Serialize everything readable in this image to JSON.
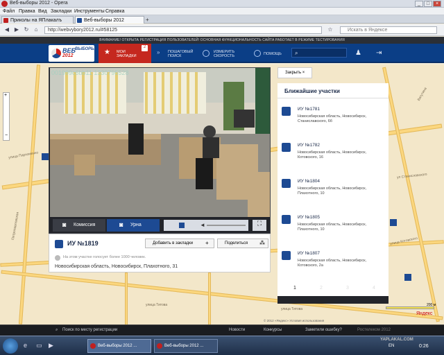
{
  "window": {
    "title": "Веб-выборы 2012 - Opera"
  },
  "menu": [
    "Файл",
    "Правка",
    "Вид",
    "Закладки",
    "Инструменты",
    "Справка"
  ],
  "tabs": [
    {
      "label": "Приколы на ЯПлакалъ"
    },
    {
      "label": "Веб-выборы 2012"
    }
  ],
  "address": {
    "url": "http://webvybory2012.ru/#58125",
    "search_placeholder": "Искать в Яндексе"
  },
  "notice": "ВНИМАНИЕ! ОТКРЫТА РЕГИСТРАЦИЯ ПОЛЬЗОВАТЕЛЕЙ! ОСНОВНАЯ ФУНКЦИОНАЛЬНОСТЬ САЙТА РАБОТАЕТ В РЕЖИМЕ ТЕСТИРОВАНИЯ",
  "site": {
    "logo_line1": "ВЕБ",
    "logo_line2": "ВЫБОРЫ",
    "logo_year": "2012",
    "bookmarks": {
      "label1": "МОИ",
      "label2": "ЗАКЛАДКИ",
      "count": "2"
    },
    "nav": [
      {
        "l1": "ПОШАГОВЫЙ",
        "l2": "ПОИСК"
      },
      {
        "l1": "ИЗМЕРИТЬ",
        "l2": "СКОРОСТЬ"
      },
      {
        "l1": "ПОМОЩЬ",
        "l2": ""
      }
    ]
  },
  "player": {
    "overlay_id": "001999c6bb11 1330795528",
    "btn_commission": "Комиссия",
    "btn_urn": "Урна"
  },
  "station": {
    "title": "ИУ №1819",
    "add_bookmark": "Добавить в закладки",
    "share": "Поделиться",
    "voters_note": "На этом участке голосует более 1000 человек.",
    "address": "Новосибирская область, Новосибирск, Плахотного, 31"
  },
  "nearby": {
    "close": "Закрыть",
    "title": "Ближайшие участки",
    "items": [
      {
        "name": "ИУ №1781",
        "address": "Новосибирская область, Новосибирск, Станиславского, 6б"
      },
      {
        "name": "ИУ №1782",
        "address": "Новосибирская область, Новосибирск, Котовского, 16"
      },
      {
        "name": "ИУ №1804",
        "address": "Новосибирская область, Новосибирск, Плахотного, 10"
      },
      {
        "name": "ИУ №1805",
        "address": "Новосибирская область, Новосибирск, Плахотного, 10"
      },
      {
        "name": "ИУ №1807",
        "address": "Новосибирская область, Новосибирск, Котовского, 2а"
      }
    ],
    "pages": [
      "1",
      "2",
      "3",
      "4"
    ]
  },
  "map": {
    "streets": [
      "улица Пархоменко",
      "улица Титова",
      "ул Станиславского",
      "улица Котовского",
      "Петропавловская",
      "Ватутина",
      "улица Титова"
    ],
    "scale": "200 м",
    "copyright": "© 2012 «Яндекс» Условия использования",
    "yandex": "Яндекс"
  },
  "footer": {
    "search_reg": "Поиск по месту регистрации",
    "news": "Новости",
    "contests": "Конкурсы",
    "report": "Заметили ошибку?",
    "rostelecom": "Ростелеком 2012"
  },
  "taskbar": {
    "window1": "Веб-выборы 2012 ...",
    "window2": "Веб-выборы 2012 ...",
    "lang": "EN",
    "time": "0:26",
    "watermark": "YAPLAKAL.COM"
  },
  "colors": {
    "site_blue": "#0b3e86",
    "bookmark_red": "#c5281f",
    "map_bg": "#f3e7c9",
    "road": "#fbd77f"
  }
}
